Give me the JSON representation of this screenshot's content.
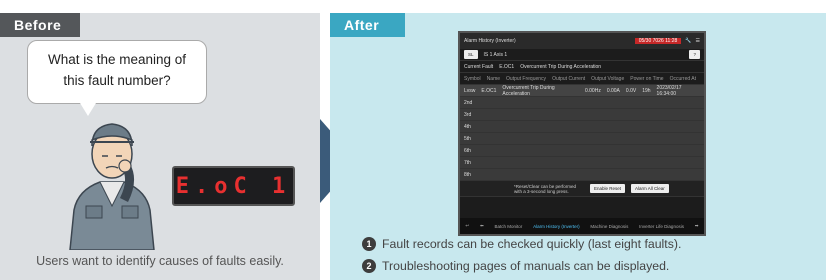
{
  "before": {
    "tab_label": "Before",
    "speech": "What is the meaning of this fault number?",
    "display_code": "E.oC 1",
    "caption": "Users want to identify causes of faults easily."
  },
  "after": {
    "tab_label": "After",
    "screen": {
      "title": "Alarm History (Inverter)",
      "time": "05/30 7026 11:28",
      "filter_a": "SL",
      "filter_b": "IS 1 Axis 1",
      "fault_label": "Current Fault",
      "fault_code": "E.OC1",
      "fault_name": "Overcurrent Trip During Acceleration",
      "col_symbol": "Symbol",
      "col_name": "Name",
      "col_freq": "Output Frequency",
      "col_current": "Output Current",
      "col_voltage": "Output Voltage",
      "col_time": "Power on Time",
      "col_occurred": "Occurred At",
      "row1_num": "Lvsw",
      "row1_code": "E.OC1",
      "row1_name": "Overcurrent Trip During Acceleration",
      "row1_freq": "0.00Hz",
      "row1_current": "0.00A",
      "row1_voltage": "0.0V",
      "row1_time": "19h",
      "row1_date": "2023/02/17 16:34:00",
      "rows": [
        "2nd",
        "3rd",
        "4th",
        "5th",
        "6th",
        "7th",
        "8th"
      ],
      "reset_note": "*Reset/Clear can be performed with a 3-second long press.",
      "btn_reset": "Enable Reset",
      "btn_clear": "Alarm All Clear",
      "nav_batch": "Batch Monitor",
      "nav_alarm": "Alarm History (Inverter)",
      "nav_machine": "Machine Diagnosis",
      "nav_inverter": "Inverter Life Diagnosis"
    },
    "items": [
      {
        "num": "1",
        "text": "Fault records can be checked quickly (last eight faults)."
      },
      {
        "num": "2",
        "text": "Troubleshooting pages of manuals can be displayed."
      }
    ]
  }
}
